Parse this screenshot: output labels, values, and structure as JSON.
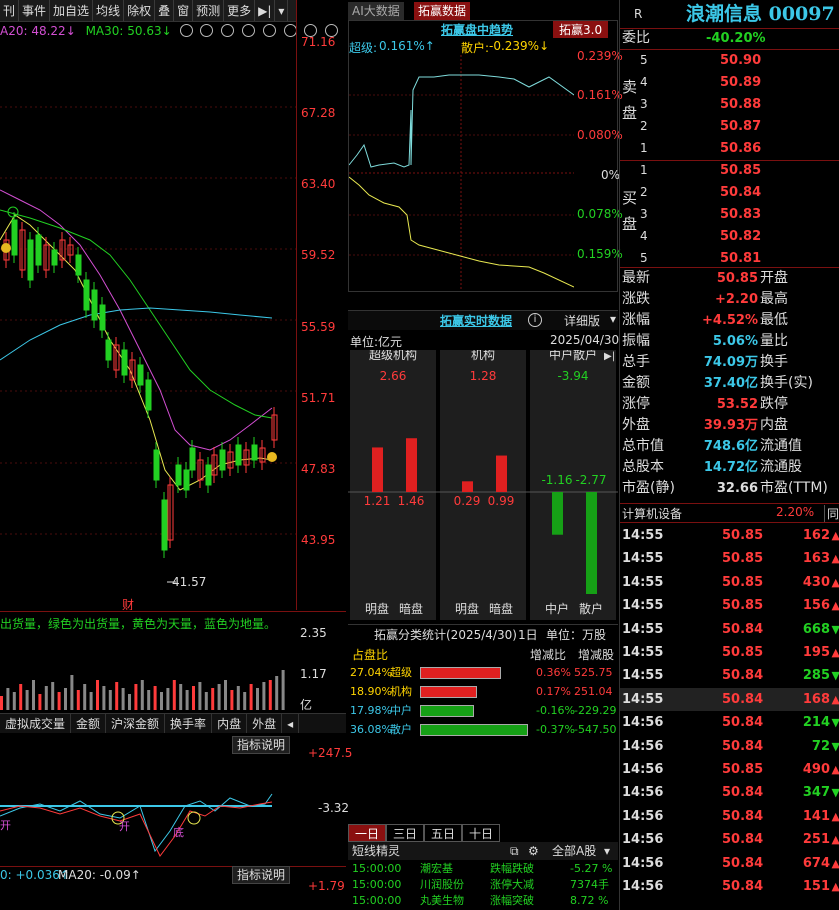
{
  "toolbar": {
    "items": [
      "事件",
      "加自选",
      "均线",
      "除权",
      "叠",
      "窗",
      "预测",
      "更多"
    ]
  },
  "ma_legend": {
    "ma20": "A20: 48.22↓",
    "ma30": "MA30: 50.63↓"
  },
  "price_axis": [
    "71.16",
    "67.28",
    "63.40",
    "59.52",
    "55.59",
    "51.71",
    "47.83",
    "43.95"
  ],
  "kline": {
    "low_label": "41.57",
    "cai_label": "财"
  },
  "volume": {
    "note": "出货量，绿色为出货量，黄色为天量，蓝色为地量。",
    "ticks": [
      "2.35",
      "1.17"
    ],
    "unit": "亿"
  },
  "ind_tabs": [
    "虚拟成交量",
    "金额",
    "沪深金额",
    "换手率",
    "内盘",
    "外盘"
  ],
  "indicator": {
    "note_btn": "指标说明",
    "ticks": [
      "+247.5",
      "-3.32"
    ],
    "marks": [
      "开",
      "开",
      "底"
    ]
  },
  "ind2": {
    "legend_a": "0: +0.036↑",
    "legend_b": "MA20: -0.09↑",
    "note_btn": "指标说明",
    "tick": "+1.79"
  },
  "mid_tabs": {
    "ai": "AI大数据",
    "tuoying": "拓赢数据",
    "intraday_title": "拓赢盘中趋势",
    "version_btn": "拓赢3.0"
  },
  "intraday": {
    "super_label": "超级:",
    "super_val": "0.161%↑",
    "retail_label": "散户:",
    "retail_val": "-0.239%↓",
    "right_labels": [
      "0.239%",
      "0.161%",
      "0.080%",
      "0%",
      "0.078%",
      "0.159%"
    ]
  },
  "realtime": {
    "title": "拓赢实时数据",
    "info": "i",
    "detail": "详细版",
    "unit": "单位:亿元",
    "date": "2025/04/30"
  },
  "columns": [
    {
      "header": "超级机构",
      "total": "2.66",
      "left_val": "1.21",
      "right_val": "1.46",
      "left_label": "明盘",
      "right_label": "暗盘",
      "left_num": 1.21,
      "right_num": 1.46
    },
    {
      "header": "机构",
      "total": "1.28",
      "left_val": "0.29",
      "right_val": "0.99",
      "left_label": "明盘",
      "right_label": "暗盘",
      "left_num": 0.29,
      "right_num": 0.99
    },
    {
      "header": "中户散户",
      "total": "-3.94",
      "left_val": "-1.16",
      "right_val": "-2.77",
      "left_label": "中户",
      "right_label": "散户",
      "left_num": -1.16,
      "right_num": -2.77
    }
  ],
  "class_stats": {
    "title": "拓赢分类统计(2025/4/30)",
    "period": "1日",
    "unit": "单位：万股",
    "h1": "占盘比",
    "h2": "增减比",
    "h3": "增减股",
    "rows": [
      {
        "pct": "27.04%",
        "name": "超级",
        "ratio": "0.36%",
        "shares": "525.75",
        "share": 27.04,
        "color": "#e02020"
      },
      {
        "pct": "18.90%",
        "name": "机构",
        "ratio": "0.17%",
        "shares": "251.04",
        "share": 18.9,
        "color": "#e02020"
      },
      {
        "pct": "17.98%",
        "name": "中户",
        "ratio": "-0.16%",
        "shares": "-229.29",
        "share": 17.98,
        "color": "#16a016"
      },
      {
        "pct": "36.08%",
        "name": "散户",
        "ratio": "-0.37%",
        "shares": "-547.50",
        "share": 36.08,
        "color": "#16a016"
      }
    ]
  },
  "period_tabs": [
    "一日",
    "三日",
    "五日",
    "十日"
  ],
  "alerts": {
    "title": "短线精灵",
    "market": "全部A股",
    "rows": [
      {
        "time": "15:00:00",
        "name": "潮宏基",
        "event": "跌幅跌破",
        "val": "-5.27 %"
      },
      {
        "time": "15:00:00",
        "name": "川润股份",
        "event": "涨停大减",
        "val": "7374手"
      },
      {
        "time": "15:00:00",
        "name": "丸美生物",
        "event": "涨幅突破",
        "val": "8.72 %"
      }
    ]
  },
  "quote": {
    "badge": "R",
    "name": "浪潮信息 00097",
    "webi_label": "委比",
    "webi_val": "-40.20%",
    "ask_label": "卖盘",
    "asks": [
      {
        "lvl": "5",
        "price": "50.90"
      },
      {
        "lvl": "4",
        "price": "50.89"
      },
      {
        "lvl": "3",
        "price": "50.88"
      },
      {
        "lvl": "2",
        "price": "50.87"
      },
      {
        "lvl": "1",
        "price": "50.86"
      }
    ],
    "bid_label": "买盘",
    "bids": [
      {
        "lvl": "1",
        "price": "50.85"
      },
      {
        "lvl": "2",
        "price": "50.84"
      },
      {
        "lvl": "3",
        "price": "50.83"
      },
      {
        "lvl": "4",
        "price": "50.82"
      },
      {
        "lvl": "5",
        "price": "50.81"
      }
    ],
    "stats": [
      {
        "l": "最新",
        "v": "50.85",
        "r": "开盘",
        "c": "red"
      },
      {
        "l": "涨跌",
        "v": "+2.20",
        "r": "最高",
        "c": "red"
      },
      {
        "l": "涨幅",
        "v": "+4.52%",
        "r": "最低",
        "c": "red"
      },
      {
        "l": "振幅",
        "v": "5.06%",
        "r": "量比",
        "c": "cyan"
      },
      {
        "l": "总手",
        "v": "74.09万",
        "r": "换手",
        "c": "cyan"
      },
      {
        "l": "金额",
        "v": "37.40亿",
        "r": "换手(实)",
        "c": "cyan"
      },
      {
        "l": "涨停",
        "v": "53.52",
        "r": "跌停",
        "c": "red"
      },
      {
        "l": "外盘",
        "v": "39.93万",
        "r": "内盘",
        "c": "red"
      },
      {
        "l": "总市值",
        "v": "748.6亿",
        "r": "流通值",
        "c": "cyan"
      },
      {
        "l": "总股本",
        "v": "14.72亿",
        "r": "流通股",
        "c": "cyan"
      },
      {
        "l": "市盈(静)",
        "v": "32.66",
        "r": "市盈(TTM)",
        "c": "wht"
      }
    ],
    "sector": "计算机设备",
    "sector_chg": "2.20%",
    "sector_more": "同"
  },
  "ticks": [
    {
      "t": "14:55",
      "p": "50.85",
      "v": "162",
      "d": "up"
    },
    {
      "t": "14:55",
      "p": "50.85",
      "v": "163",
      "d": "up"
    },
    {
      "t": "14:55",
      "p": "50.85",
      "v": "430",
      "d": "up"
    },
    {
      "t": "14:55",
      "p": "50.85",
      "v": "156",
      "d": "up"
    },
    {
      "t": "14:55",
      "p": "50.84",
      "v": "668",
      "d": "down"
    },
    {
      "t": "14:55",
      "p": "50.85",
      "v": "195",
      "d": "up"
    },
    {
      "t": "14:55",
      "p": "50.84",
      "v": "285",
      "d": "down"
    },
    {
      "t": "14:55",
      "p": "50.84",
      "v": "168",
      "d": "up"
    },
    {
      "t": "14:56",
      "p": "50.84",
      "v": "214",
      "d": "down"
    },
    {
      "t": "14:56",
      "p": "50.84",
      "v": "72",
      "d": "down"
    },
    {
      "t": "14:56",
      "p": "50.85",
      "v": "490",
      "d": "up"
    },
    {
      "t": "14:56",
      "p": "50.84",
      "v": "347",
      "d": "down"
    },
    {
      "t": "14:56",
      "p": "50.84",
      "v": "141",
      "d": "up"
    },
    {
      "t": "14:56",
      "p": "50.84",
      "v": "251",
      "d": "up"
    },
    {
      "t": "14:56",
      "p": "50.84",
      "v": "674",
      "d": "up"
    },
    {
      "t": "14:56",
      "p": "50.84",
      "v": "151",
      "d": "up"
    }
  ]
}
